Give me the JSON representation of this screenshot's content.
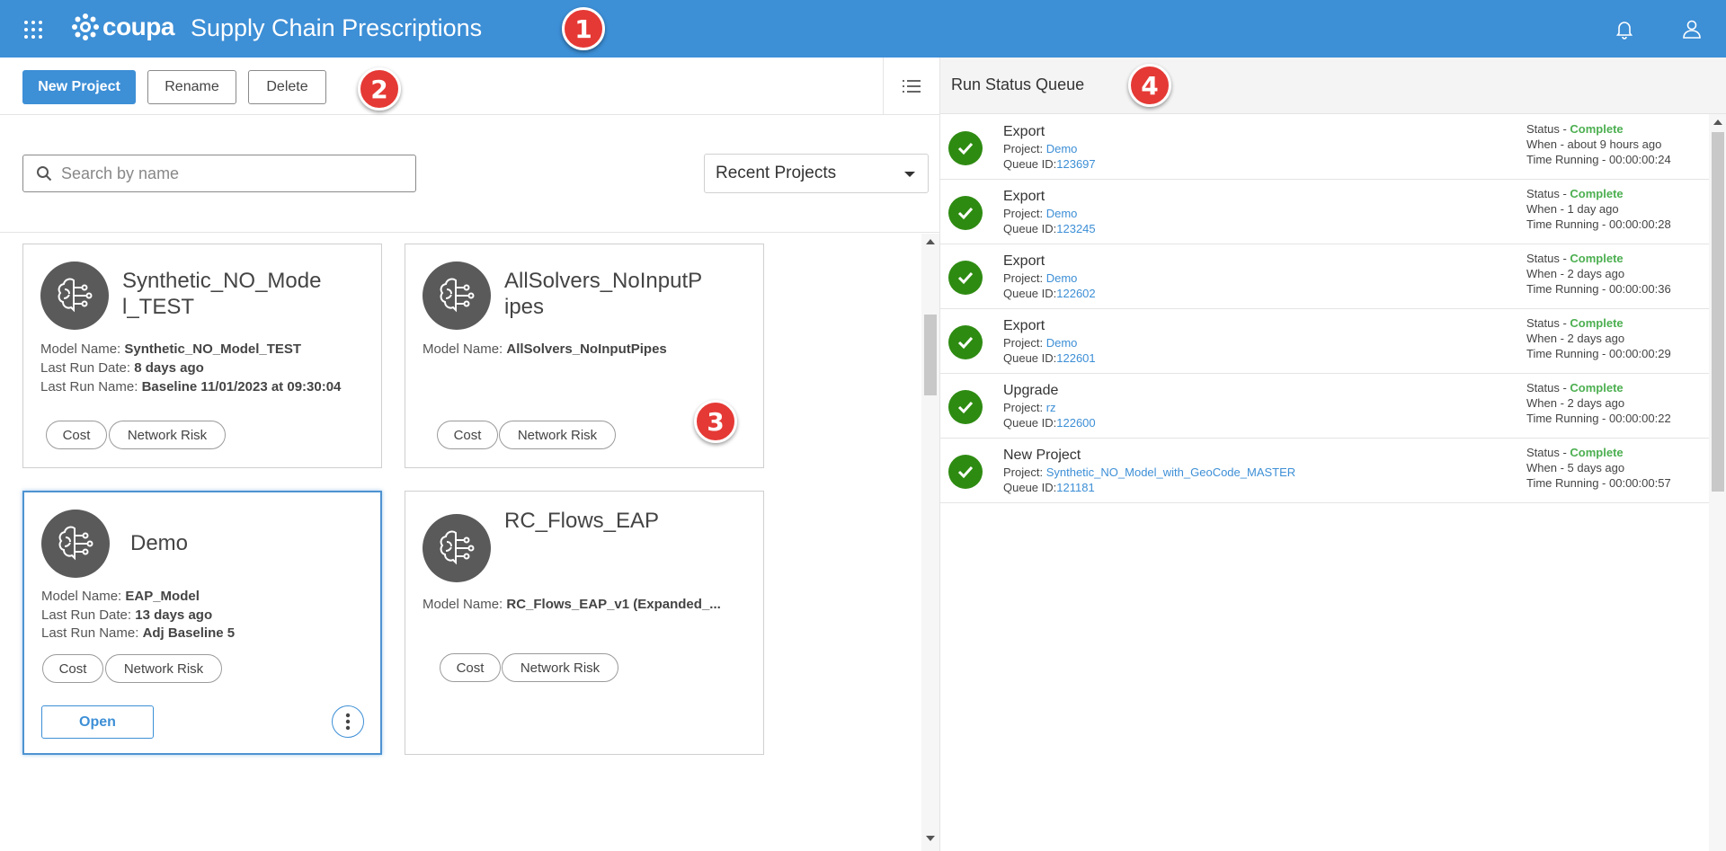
{
  "header": {
    "brand": "coupa",
    "title": "Supply Chain Prescriptions"
  },
  "callouts": [
    "1",
    "2",
    "3",
    "4"
  ],
  "toolbar": {
    "new_project": "New Project",
    "rename": "Rename",
    "delete": "Delete"
  },
  "search": {
    "placeholder": "Search by name"
  },
  "filter": {
    "selected": "Recent Projects"
  },
  "cards": [
    {
      "title_line1": "Synthetic_NO_Mode",
      "title_line2": "l_TEST",
      "model_label": "Model Name:",
      "model_name": "Synthetic_NO_Model_TEST",
      "run_date_label": "Last Run Date:",
      "run_date": "8 days ago",
      "run_name_label": "Last Run Name:",
      "run_name": "Baseline 11/01/2023 at 09:30:04",
      "tags": [
        "Cost",
        "Network Risk"
      ]
    },
    {
      "title_line1": "AllSolvers_NoInputP",
      "title_line2": "ipes",
      "model_label": "Model Name:",
      "model_name": "AllSolvers_NoInputPipes",
      "tags": [
        "Cost",
        "Network Risk"
      ]
    },
    {
      "title_line1": "Demo",
      "model_label": "Model Name:",
      "model_name": "EAP_Model",
      "run_date_label": "Last Run Date:",
      "run_date": "13 days ago",
      "run_name_label": "Last Run Name:",
      "run_name": "Adj Baseline 5",
      "tags": [
        "Cost",
        "Network Risk"
      ],
      "open_label": "Open"
    },
    {
      "title_line1": "RC_Flows_EAP",
      "model_label": "Model Name:",
      "model_name": "RC_Flows_EAP_v1 (Expanded_...",
      "tags": [
        "Cost",
        "Network Risk"
      ]
    }
  ],
  "queue": {
    "title": "Run Status Queue",
    "status_label": "Status -",
    "project_label": "Project:",
    "queue_id_label": "Queue ID:",
    "items": [
      {
        "type": "Export",
        "project": "Demo",
        "queue_id": "123697",
        "status": "Complete",
        "when": "When - about 9 hours ago",
        "time": "Time Running - 00:00:00:24"
      },
      {
        "type": "Export",
        "project": "Demo",
        "queue_id": "123245",
        "status": "Complete",
        "when": "When - 1 day ago",
        "time": "Time Running - 00:00:00:28"
      },
      {
        "type": "Export",
        "project": "Demo",
        "queue_id": "122602",
        "status": "Complete",
        "when": "When - 2 days ago",
        "time": "Time Running - 00:00:00:36"
      },
      {
        "type": "Export",
        "project": "Demo",
        "queue_id": "122601",
        "status": "Complete",
        "when": "When - 2 days ago",
        "time": "Time Running - 00:00:00:29"
      },
      {
        "type": "Upgrade",
        "project": "rz",
        "queue_id": "122600",
        "status": "Complete",
        "when": "When - 2 days ago",
        "time": "Time Running - 00:00:00:22"
      },
      {
        "type": "New Project",
        "project": "Synthetic_NO_Model_with_GeoCode_MASTER",
        "queue_id": "121181",
        "status": "Complete",
        "when": "When - 5 days ago",
        "time": "Time Running - 00:00:00:57"
      }
    ]
  },
  "colors": {
    "brand_blue": "#3d8fd6",
    "success_green": "#2e8b12",
    "complete_text": "#4caf50",
    "callout_red": "#e53935"
  }
}
